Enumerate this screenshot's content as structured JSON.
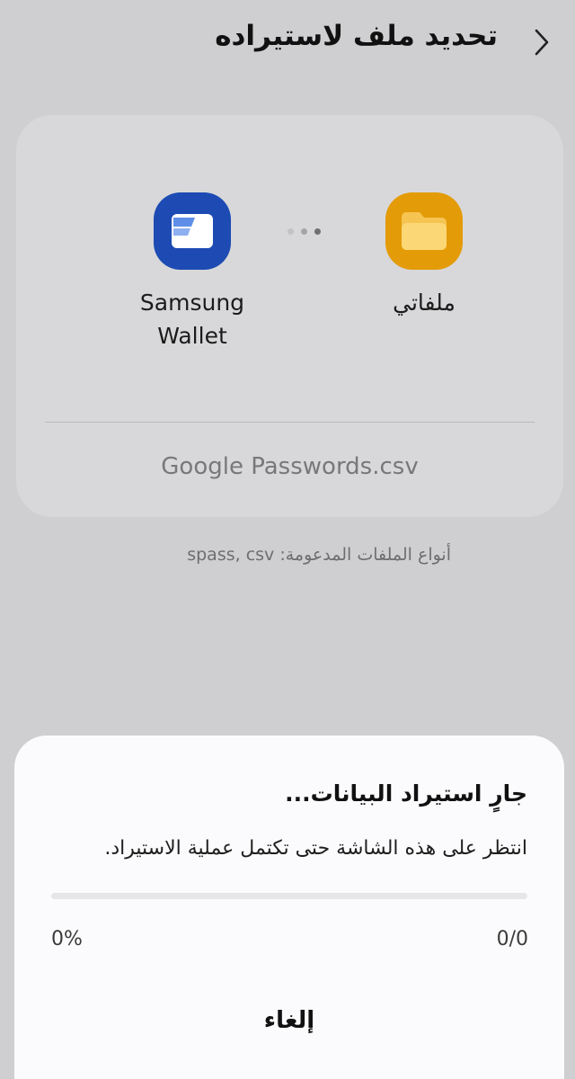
{
  "header": {
    "title": "تحديد ملف لاستيراده",
    "back_icon": "chevron-right-icon"
  },
  "source_card": {
    "apps": [
      {
        "label": "Samsung\nWallet",
        "icon": "samsung-wallet-icon",
        "color": "#1d4bb3"
      },
      {
        "label": "ملفاتي",
        "icon": "folder-icon",
        "color": "#e39b08"
      }
    ],
    "file_name": "Google Passwords.csv"
  },
  "supported_types": "أنواع الملفات المدعومة: spass, csv",
  "dialog": {
    "title": "جارٍ استيراد البيانات...",
    "message": "انتظر على هذه الشاشة حتى تكتمل عملية الاستيراد.",
    "progress": 0,
    "percent_label": "0%",
    "count_label": "0/0",
    "cancel_label": "إلغاء"
  }
}
